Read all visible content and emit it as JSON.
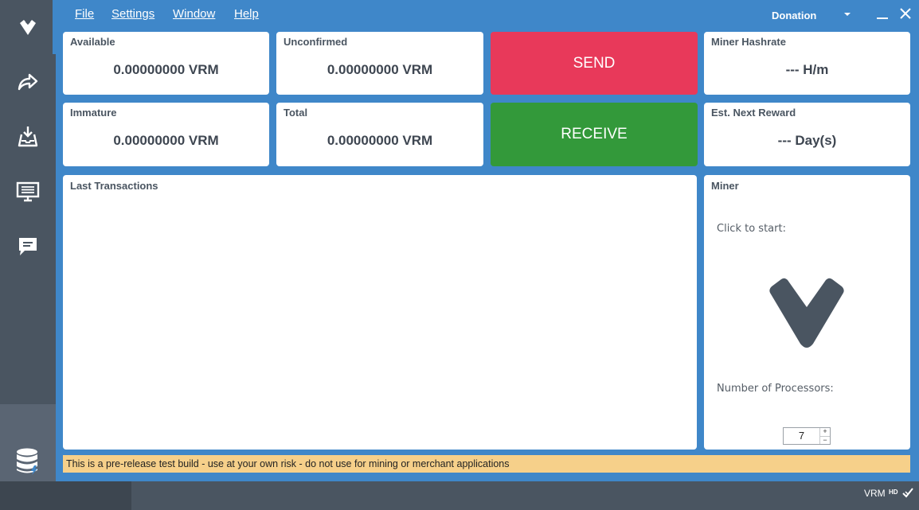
{
  "menu": {
    "file_label": "File",
    "settings_label": "Settings",
    "window_label": "Window",
    "help_label": "Help",
    "donation_label": "Donation"
  },
  "sidebar": {
    "items": [
      {
        "name": "overview",
        "icon": "vericoin-logo-icon"
      },
      {
        "name": "send",
        "icon": "send-arrow-icon"
      },
      {
        "name": "receive",
        "icon": "receive-tray-icon"
      },
      {
        "name": "transactions",
        "icon": "monitor-list-icon"
      },
      {
        "name": "chat",
        "icon": "chat-bubble-icon"
      }
    ],
    "bottom_icon": "database-icon"
  },
  "balances": {
    "available_title": "Available",
    "available_value": "0.00000000 VRM",
    "unconfirmed_title": "Unconfirmed",
    "unconfirmed_value": "0.00000000 VRM",
    "immature_title": "Immature",
    "immature_value": "0.00000000 VRM",
    "total_title": "Total",
    "total_value": "0.00000000 VRM"
  },
  "actions": {
    "send_label": "SEND",
    "receive_label": "RECEIVE",
    "send_color": "#e8395a",
    "receive_color": "#33993a"
  },
  "stats": {
    "hashrate_title": "Miner Hashrate",
    "hashrate_value": "--- H/m",
    "reward_title": "Est. Next Reward",
    "reward_value": "--- Day(s)"
  },
  "transactions": {
    "title": "Last Transactions"
  },
  "miner": {
    "title": "Miner",
    "click_to_start": "Click to start:",
    "processors_label": "Number of Processors:",
    "processors_value": "7",
    "spin_up": "+",
    "spin_down": "−"
  },
  "warning": {
    "text": "This is a pre-release test build - use at your own risk - do not use for mining or merchant applications"
  },
  "status": {
    "unit": "VRM",
    "hd": "HD"
  },
  "colors": {
    "main_bg": "#3f87c9",
    "sidebar_bg": "#4a5561",
    "warning_bg": "#f6d08a"
  }
}
